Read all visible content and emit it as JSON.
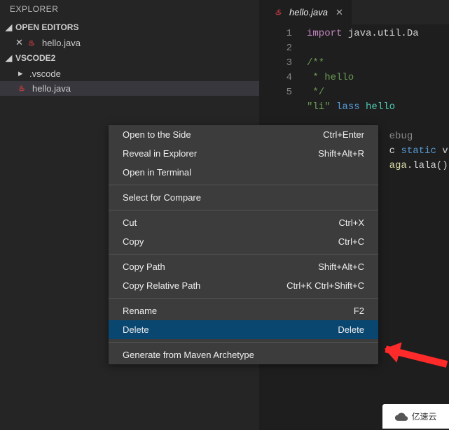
{
  "sidebar": {
    "title": "EXPLORER",
    "sections": {
      "open_editors": {
        "label": "OPEN EDITORS"
      },
      "workspace": {
        "label": "VSCODE2"
      }
    },
    "open_files": [
      {
        "name": "hello.java",
        "closeable": true
      }
    ],
    "tree": [
      {
        "name": ".vscode",
        "type": "folder"
      },
      {
        "name": "hello.java",
        "type": "file",
        "selected": true
      }
    ]
  },
  "tab": {
    "filename": "hello.java"
  },
  "code": {
    "line_numbers": [
      "1",
      "2",
      "3",
      "4",
      "5"
    ],
    "l1_kw": "import",
    "l1_rest": " java.util.Da",
    "l3": "/**",
    "l4": " * hello",
    "l5": " */",
    "l6_pre": "\"li\" ",
    "l6_kw": "lass",
    "l6_cls": " hello",
    "l7": "ebug",
    "l8_pre": "c ",
    "l8_kw": "static",
    "l8_post": " v",
    "l9_fn": "aga",
    "l9_call": ".lala()"
  },
  "menu": [
    {
      "label": "Open to the Side",
      "shortcut": "Ctrl+Enter"
    },
    {
      "label": "Reveal in Explorer",
      "shortcut": "Shift+Alt+R"
    },
    {
      "label": "Open in Terminal",
      "shortcut": ""
    },
    {
      "sep": true
    },
    {
      "label": "Select for Compare",
      "shortcut": ""
    },
    {
      "sep": true
    },
    {
      "label": "Cut",
      "shortcut": "Ctrl+X"
    },
    {
      "label": "Copy",
      "shortcut": "Ctrl+C"
    },
    {
      "sep": true
    },
    {
      "label": "Copy Path",
      "shortcut": "Shift+Alt+C"
    },
    {
      "label": "Copy Relative Path",
      "shortcut": "Ctrl+K Ctrl+Shift+C"
    },
    {
      "sep": true
    },
    {
      "label": "Rename",
      "shortcut": "F2"
    },
    {
      "label": "Delete",
      "shortcut": "Delete",
      "highlight": true
    },
    {
      "sep": true
    },
    {
      "label": "Generate from Maven Archetype",
      "shortcut": ""
    }
  ],
  "watermark": "亿速云"
}
